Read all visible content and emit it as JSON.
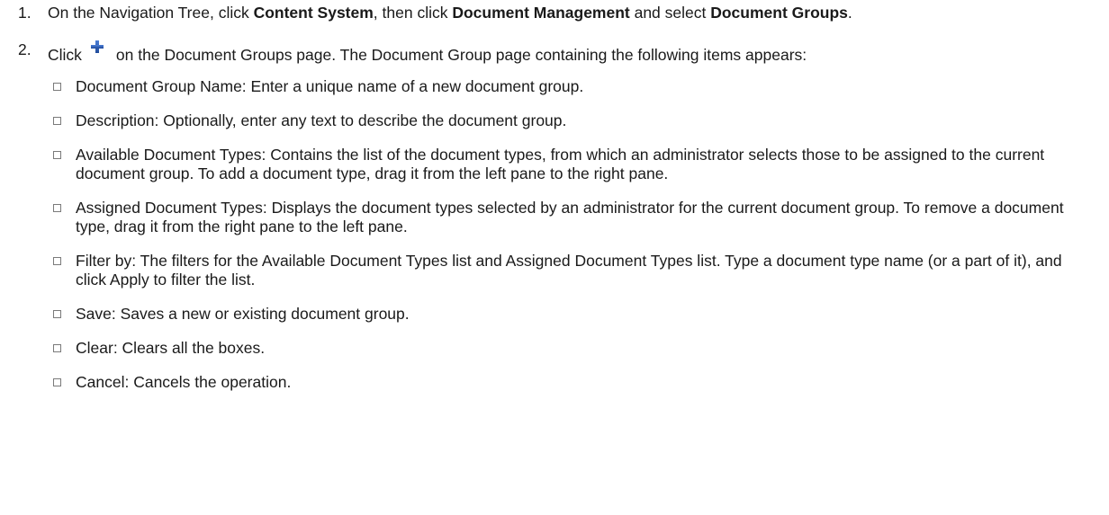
{
  "steps": [
    {
      "number": "1.",
      "parts": {
        "a": "On the Navigation Tree, click ",
        "b1": "Content System",
        "c": ", then click ",
        "b2": "Document Management",
        "d": " and select ",
        "b3": "Document Groups",
        "e": "."
      }
    },
    {
      "number": "2.",
      "before_icon": "Click",
      "icon": "plus-icon",
      "after_icon": "on the Document Groups page. The Document Group page containing the following items appears:",
      "items": [
        "Document Group Name: Enter a unique name of a new document group.",
        "Description: Optionally, enter any text to describe the document group.",
        "Available Document Types: Contains the list of the document types, from which an administrator selects those to be assigned to the current document group. To add a document type, drag it from the left pane to the right pane.",
        "Assigned Document Types: Displays the document types selected by an administrator for the current document group. To remove a document type, drag it from the right pane to the left pane.",
        "Filter by: The filters for the Available Document Types list and Assigned Document Types list. Type a document type name (or a part of it), and click Apply to filter the list.",
        "Save: Saves a new or existing document group.",
        "Clear: Clears all the boxes.",
        "Cancel: Cancels the operation."
      ]
    }
  ],
  "colors": {
    "text": "#1a1a1a",
    "plus_icon_blue": "#2f5fb3",
    "checkbox_border": "#7a7a7a"
  }
}
